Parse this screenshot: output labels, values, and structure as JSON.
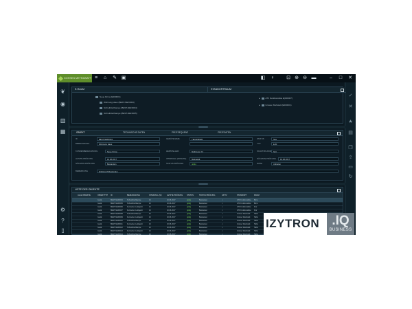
{
  "app": {
    "brand": "GOSSEN METRAWATT",
    "toolbar_icons": [
      "menu-icon",
      "home-icon",
      "pin-icon",
      "image-icon",
      "panel-icon",
      "bulb-icon",
      "fit-icon",
      "zoom-in-icon",
      "zoom-out-icon",
      "window-icon",
      "minimize-icon",
      "maximize-icon",
      "close-icon"
    ]
  },
  "left_sidebar": [
    "leaf-icon",
    "globe-icon",
    "building-icon",
    "grid-icon",
    "settings-icon",
    "help-icon",
    "trash-icon"
  ],
  "right_sidebar": [
    "check-icon",
    "x-icon",
    "star-icon",
    "calendar-icon",
    "copy-icon",
    "export-icon",
    "folder-icon",
    "refresh-icon"
  ],
  "tree_panel": {
    "title": "E-RAUM",
    "items": [
      "Neue Firma (E000001)",
      "Wohnung Haus (BEST-NEF0003)",
      "Schreibtischlampe (BEST-NEF0004)",
      "Schreibtischlampe (BEST-NEF0005)"
    ]
  },
  "location_panel": {
    "title": "STANDORTRAUM",
    "items": [
      "ATF Funktionsliste E(000007)",
      "Grosse Werkstatt (E000001)"
    ]
  },
  "detail_panel": {
    "tabs": [
      "OBJEKT",
      "TECHNISCHE DATEN",
      "PRÜFSEQUENZ",
      "PRÜFDATEN"
    ],
    "fields": [
      {
        "label": "ID",
        "value": "BEST-NEF0004"
      },
      {
        "label": "BEZEICHNUNG",
        "value": "Wohnung Haus"
      },
      {
        "label": "KUNDENBEZEICHNUNG",
        "value": "Neue Firma"
      },
      {
        "label": "LETZTE PRÜFUNG",
        "value": "10.06.2017"
      },
      {
        "label": "NÄCHSTE PRÜFUNG",
        "value": "Bestanden"
      },
      {
        "label": "BEMERKUNG",
        "value": "Erfolgreich Bestanden"
      },
      {
        "label": "GERÄTENAME",
        "value": "TECHNIKER"
      },
      {
        "label": "HERSTELLER",
        "value": "Metrawatt"
      },
      {
        "label": "TYPEN",
        "value": "Multimeter XI"
      },
      {
        "label": "INTERVALL (MONATE)",
        "value": "12"
      },
      {
        "label": "STATUS PRÜFUNG",
        "value": "gültig"
      },
      {
        "label": "STATUS",
        "value": "Neu"
      },
      {
        "label": "TYP",
        "value": "E-Kl"
      },
      {
        "label": "SCHUTZKLASSE",
        "value": "SK I"
      },
      {
        "label": "NÄCHSTE PRÜFUNG",
        "value": "10.06.2017"
      },
      {
        "label": "DATEI",
        "value": "Anbieten"
      }
    ]
  },
  "list_panel": {
    "title": "LISTE DER OBJEKTE",
    "columns": [
      "ALLE OBJEKTE",
      "OBJEKTTYP",
      "ID",
      "BEZEICHNUNG",
      "INTERVALL (M)",
      "LETZTE PRÜFUNG",
      "STATUS",
      "STATUS PRÜFUNG",
      "AKTIV",
      "STANDORT",
      "RAUM"
    ],
    "rows": [
      [
        "",
        "Gerät",
        "BEST-NEF0004",
        "Schreibtischlampe",
        "12",
        "10.06.2017",
        "gültig",
        "Bestanden",
        "✓",
        "ATF Funktionsliste",
        "Büro"
      ],
      [
        "",
        "Gerät",
        "BEST-NEF0005",
        "Schreibtischlampe",
        "12",
        "10.06.2017",
        "gültig",
        "Bestanden",
        "✓",
        "ATF Funktionsliste",
        "Büro"
      ],
      [
        "",
        "Gerät",
        "BEST-NEF0006",
        "Fernseher Lodigerät",
        "12",
        "10.06.2017",
        "gültig",
        "Bestanden",
        "✓",
        "ATF Funktionsliste",
        "Flur"
      ],
      [
        "",
        "Gerät",
        "BEST-NEF0007",
        "Fernseher Lodigerät",
        "12",
        "10.06.2017",
        "gültig",
        "Bestanden",
        "✓",
        "ATF Funktionsliste",
        "Flur"
      ],
      [
        "",
        "Gerät",
        "BEST-NEF0008",
        "Schreibtischlampe",
        "12",
        "10.06.2017",
        "gültig",
        "Bestanden",
        "✓",
        "Grosse Werkstatt",
        "Halle"
      ],
      [
        "",
        "Gerät",
        "BEST-NEF0009",
        "Fernseher Lodigerät",
        "12",
        "10.06.2017",
        "gültig",
        "Bestanden",
        "✓",
        "Grosse Werkstatt",
        "Halle"
      ],
      [
        "",
        "Gerät",
        "BEST-NEF0010",
        "Schreibtischlampe",
        "12",
        "10.06.2017",
        "gültig",
        "Bestanden",
        "✓",
        "Grosse Werkstatt",
        "Halle"
      ],
      [
        "",
        "Gerät",
        "BEST-NEF0011",
        "Fernseher Lodigerät",
        "12",
        "10.06.2017",
        "gültig",
        "Bestanden",
        "✓",
        "Grosse Werkstatt",
        "Halle"
      ],
      [
        "",
        "Gerät",
        "BEST-NEF0012",
        "Schreibtischlampe",
        "12",
        "10.06.2017",
        "gültig",
        "Bestanden",
        "✓",
        "Grosse Werkstatt",
        "Halle"
      ],
      [
        "",
        "Gerät",
        "BEST-NEF0013",
        "Fernseher Lodigerät",
        "12",
        "10.06.2017",
        "gültig",
        "Bestanden",
        "✓",
        "Grosse Werkstatt",
        "Halle"
      ],
      [
        "",
        "Gerät",
        "BEST-NEF0014",
        "Schreibtischlampe",
        "12",
        "10.06.2017",
        "gültig",
        "Bestanden",
        "✓",
        "Grosse Werkstatt",
        "Halle"
      ]
    ]
  },
  "watermark": {
    "main": "IZYTRON",
    "iq": ".IQ",
    "sub": "BUSINESS"
  }
}
